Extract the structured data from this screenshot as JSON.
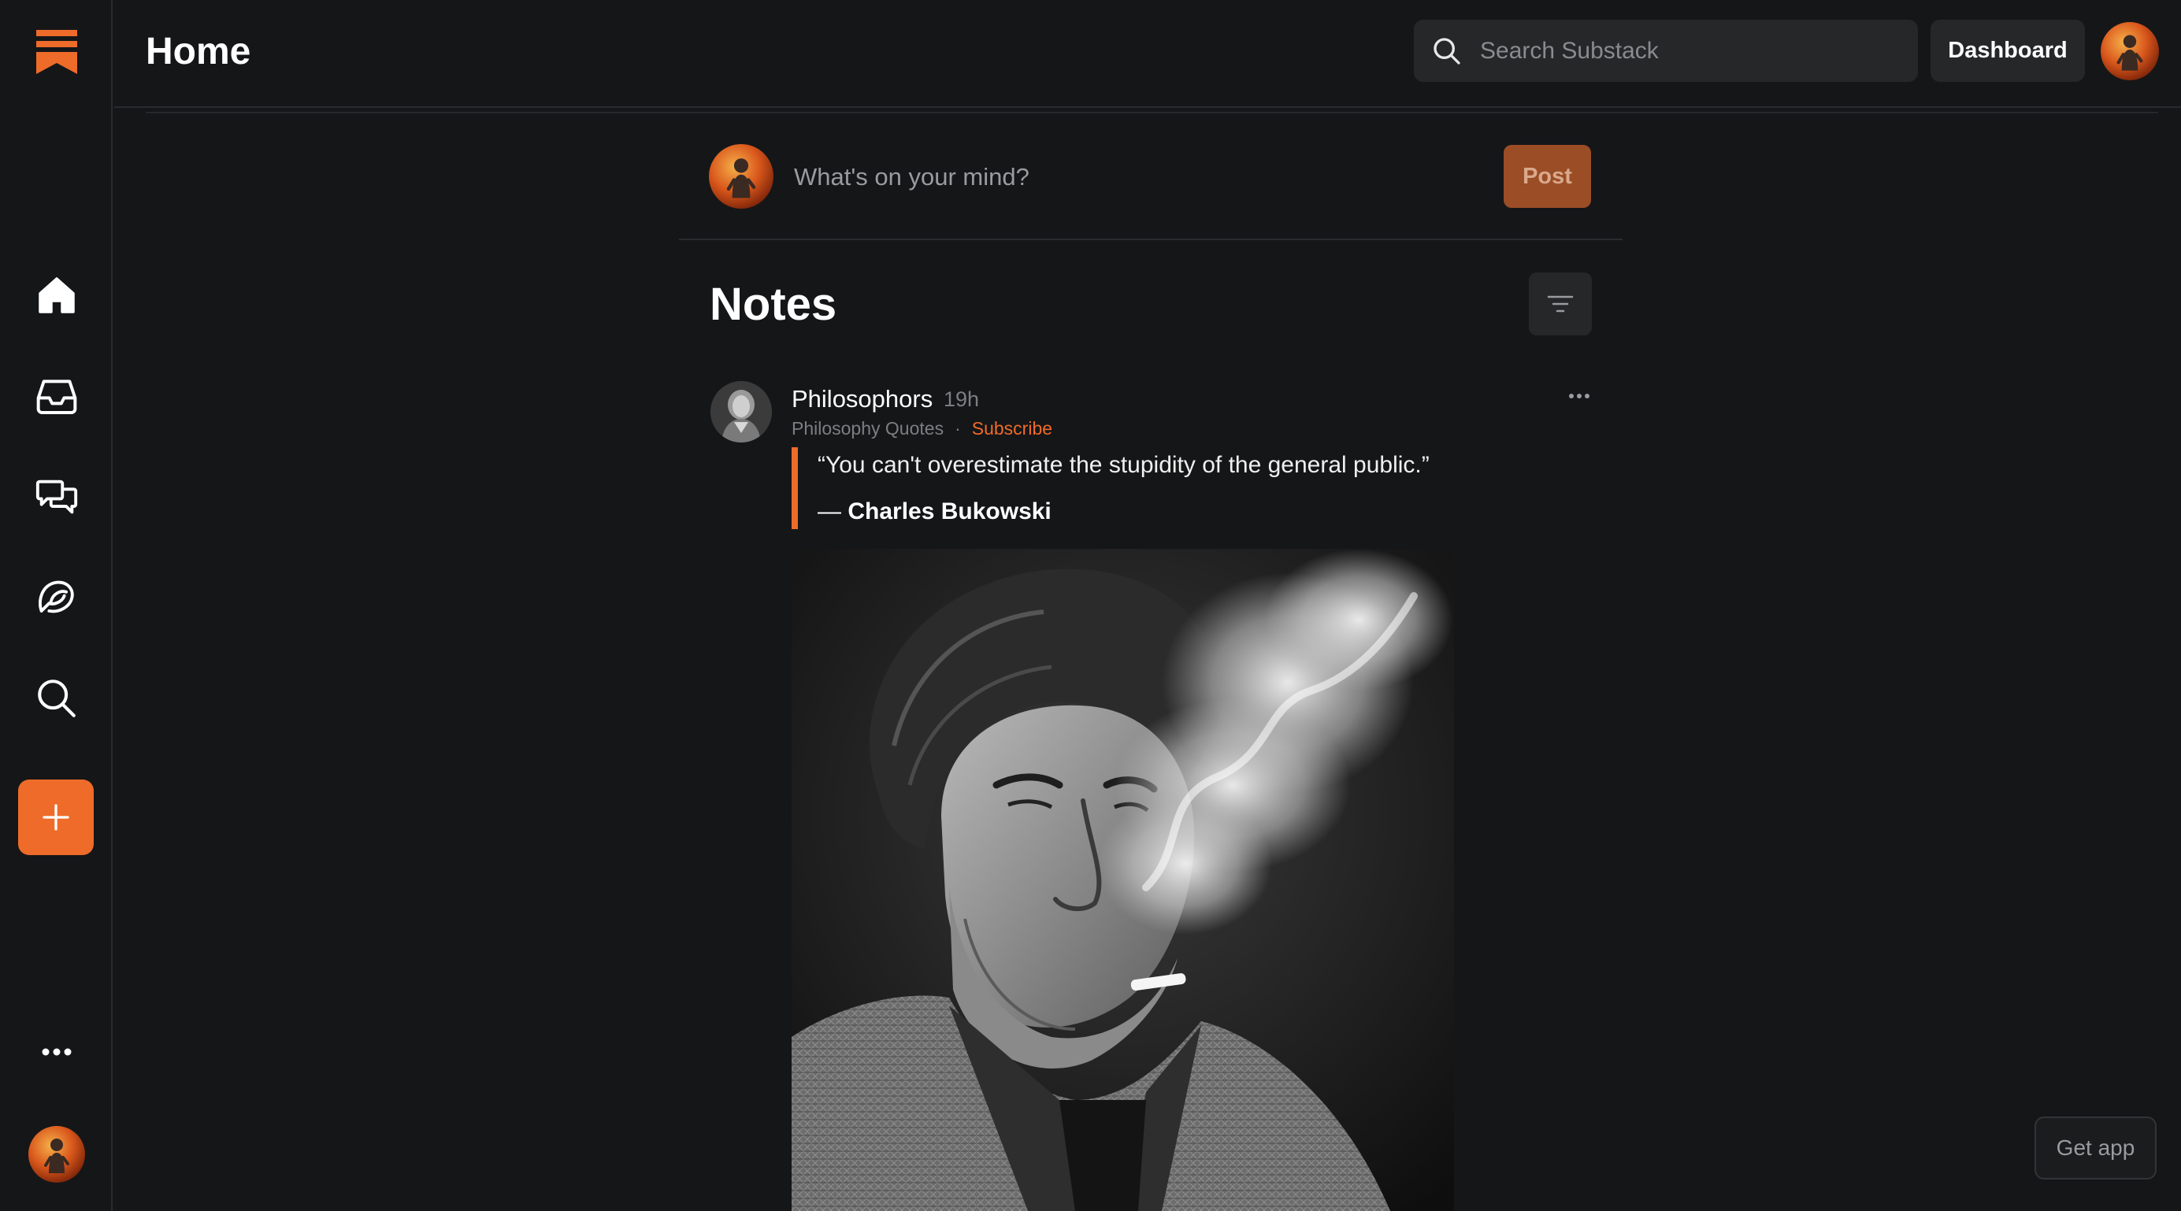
{
  "header": {
    "title": "Home",
    "search_placeholder": "Search Substack",
    "dashboard_label": "Dashboard"
  },
  "sidebar": {
    "items": [
      {
        "name": "home",
        "icon": "home-icon"
      },
      {
        "name": "inbox",
        "icon": "inbox-icon"
      },
      {
        "name": "chat",
        "icon": "chat-icon"
      },
      {
        "name": "activity",
        "icon": "activity-icon"
      },
      {
        "name": "search",
        "icon": "search-icon"
      }
    ],
    "create_icon": "plus-icon",
    "more_icon": "more-icon"
  },
  "composer": {
    "placeholder": "What's on your mind?",
    "post_label": "Post"
  },
  "notes": {
    "title": "Notes",
    "filter_icon": "filter-icon"
  },
  "note": {
    "author": "Philosophors",
    "time": "19h",
    "publication": "Philosophy Quotes",
    "separator": "·",
    "subscribe_label": "Subscribe",
    "quote": "“You can't overestimate the stupidity of the general public.”",
    "quote_dash": "— ",
    "quote_author": "Charles Bukowski"
  },
  "get_app_label": "Get app",
  "colors": {
    "accent": "#ee6b2a",
    "background": "#151618",
    "surface": "#262729",
    "post_button": "#9b4d26"
  }
}
